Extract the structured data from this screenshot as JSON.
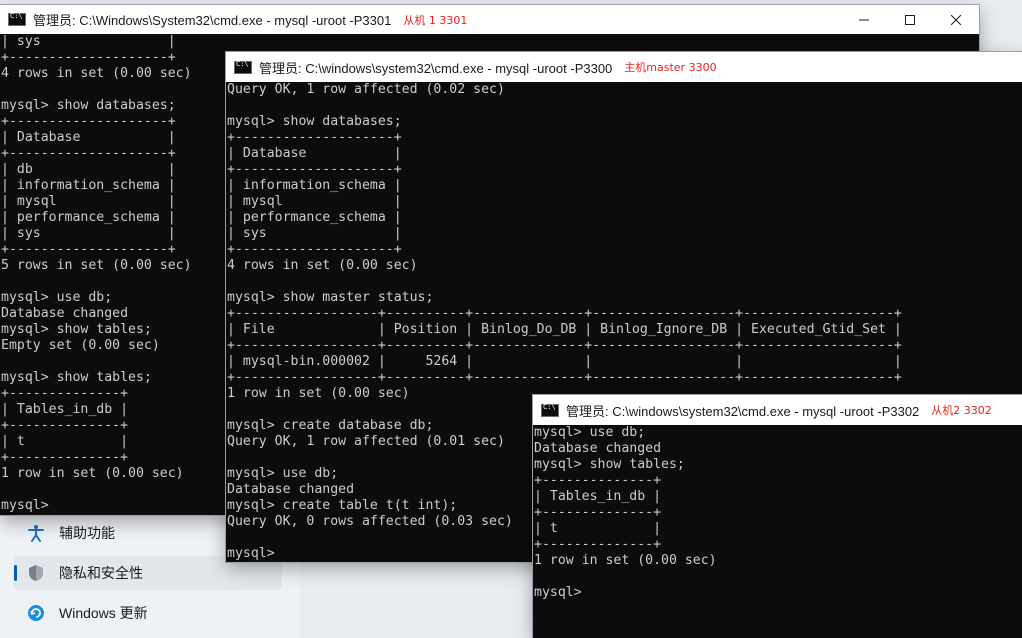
{
  "settings": {
    "items": [
      {
        "label": "辅助功能",
        "icon": "accessibility-icon",
        "selected": false
      },
      {
        "label": "隐私和安全性",
        "icon": "shield-icon",
        "selected": true
      },
      {
        "label": "Windows 更新",
        "icon": "windows-update-icon",
        "selected": false
      }
    ]
  },
  "windows": {
    "slave1": {
      "title": "管理员: C:\\Windows\\System32\\cmd.exe - mysql  -uroot -P3301",
      "annotation": "从机 1 3301",
      "lines": [
        "| sys                |",
        "+--------------------+",
        "4 rows in set (0.00 sec)",
        "",
        "mysql> show databases;",
        "+--------------------+",
        "| Database           |",
        "+--------------------+",
        "| db                 |",
        "| information_schema |",
        "| mysql              |",
        "| performance_schema |",
        "| sys                |",
        "+--------------------+",
        "5 rows in set (0.00 sec)",
        "",
        "mysql> use db;",
        "Database changed",
        "mysql> show tables;",
        "Empty set (0.00 sec)",
        "",
        "mysql> show tables;",
        "+--------------+",
        "| Tables_in_db |",
        "+--------------+",
        "| t            |",
        "+--------------+",
        "1 row in set (0.00 sec)",
        "",
        "mysql>"
      ]
    },
    "master": {
      "title": "管理员: C:\\windows\\system32\\cmd.exe - mysql  -uroot -P3300",
      "annotation": "主机master 3300",
      "lines": [
        "Query OK, 1 row affected (0.02 sec)",
        "",
        "mysql> show databases;",
        "+--------------------+",
        "| Database           |",
        "+--------------------+",
        "| information_schema |",
        "| mysql              |",
        "| performance_schema |",
        "| sys                |",
        "+--------------------+",
        "4 rows in set (0.00 sec)",
        "",
        "mysql> show master status;",
        "+------------------+----------+--------------+------------------+-------------------+",
        "| File             | Position | Binlog_Do_DB | Binlog_Ignore_DB | Executed_Gtid_Set |",
        "+------------------+----------+--------------+------------------+-------------------+",
        "| mysql-bin.000002 |     5264 |              |                  |                   |",
        "+------------------+----------+--------------+------------------+-------------------+",
        "1 row in set (0.00 sec)",
        "",
        "mysql> create database db;",
        "Query OK, 1 row affected (0.01 sec)",
        "",
        "mysql> use db;",
        "Database changed",
        "mysql> create table t(t int);",
        "Query OK, 0 rows affected (0.03 sec)",
        "",
        "mysql>"
      ]
    },
    "slave2": {
      "title": "管理员: C:\\windows\\system32\\cmd.exe - mysql  -uroot -P3302",
      "annotation": "从机2 3302",
      "lines": [
        "mysql> use db;",
        "Database changed",
        "mysql> show tables;",
        "+--------------+",
        "| Tables_in_db |",
        "+--------------+",
        "| t            |",
        "+--------------+",
        "1 row in set (0.00 sec)",
        "",
        "mysql>"
      ]
    }
  },
  "colors": {
    "console_bg": "#0c0c0c",
    "console_fg": "#cccccc",
    "annotation": "#e8231c",
    "accent": "#005fb8"
  }
}
